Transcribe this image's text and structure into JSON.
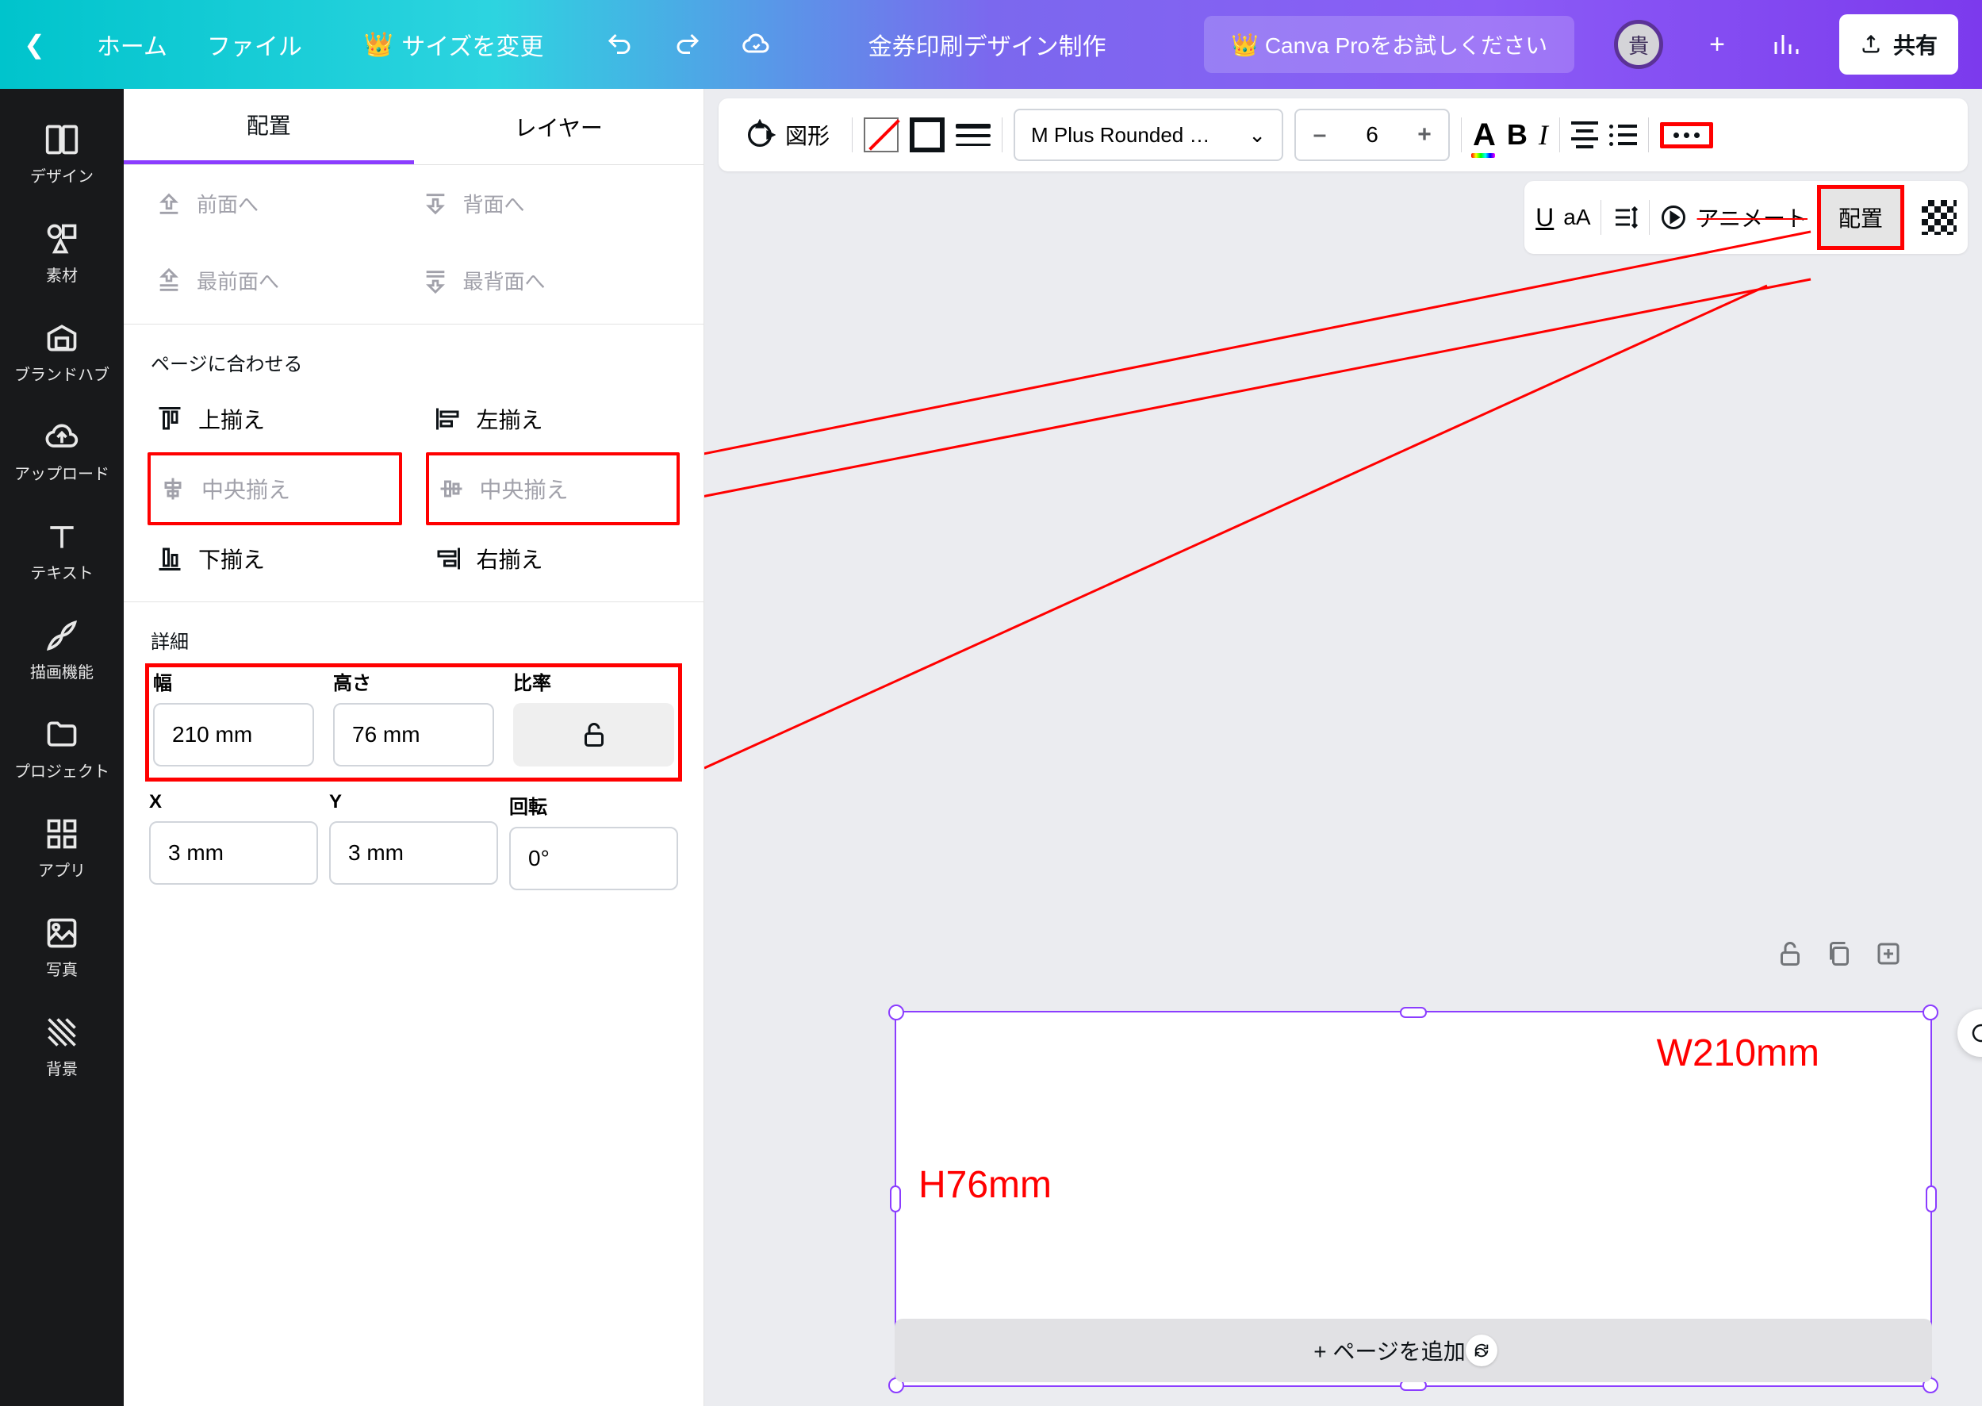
{
  "topbar": {
    "home": "ホーム",
    "file": "ファイル",
    "resize": "サイズを変更",
    "title": "金券印刷デザイン制作",
    "pro": "Canva Proをお試しください",
    "avatar": "貴",
    "share": "共有"
  },
  "leftnav": {
    "design": "デザイン",
    "elements": "素材",
    "brand": "ブランドハブ",
    "upload": "アップロード",
    "text": "テキスト",
    "draw": "描画機能",
    "projects": "プロジェクト",
    "apps": "アプリ",
    "photos": "写真",
    "bg": "背景"
  },
  "panel": {
    "tabs": {
      "pos": "配置",
      "layer": "レイヤー"
    },
    "layer": {
      "front": "前面へ",
      "back": "背面へ",
      "frontmost": "最前面へ",
      "backmost": "最背面へ"
    },
    "fit_title": "ページに合わせる",
    "align": {
      "top": "上揃え",
      "left": "左揃え",
      "center_h": "中央揃え",
      "center_v": "中央揃え",
      "bottom": "下揃え",
      "right": "右揃え"
    },
    "detail_title": "詳細",
    "width_label": "幅",
    "height_label": "高さ",
    "ratio_label": "比率",
    "width": "210 mm",
    "height": "76 mm",
    "x_label": "X",
    "y_label": "Y",
    "rot_label": "回転",
    "x": "3 mm",
    "y": "3 mm",
    "rot": "0°"
  },
  "toolbar": {
    "shape": "図形",
    "font": "M Plus Rounded …",
    "size": "6",
    "minus": "–",
    "plus": "+"
  },
  "toolbar2": {
    "aA": "aA",
    "animate": "アニメート",
    "position": "配置"
  },
  "canvas": {
    "wdim": "W210mm",
    "hdim": "H76mm",
    "addpage": "+ ページを追加"
  }
}
